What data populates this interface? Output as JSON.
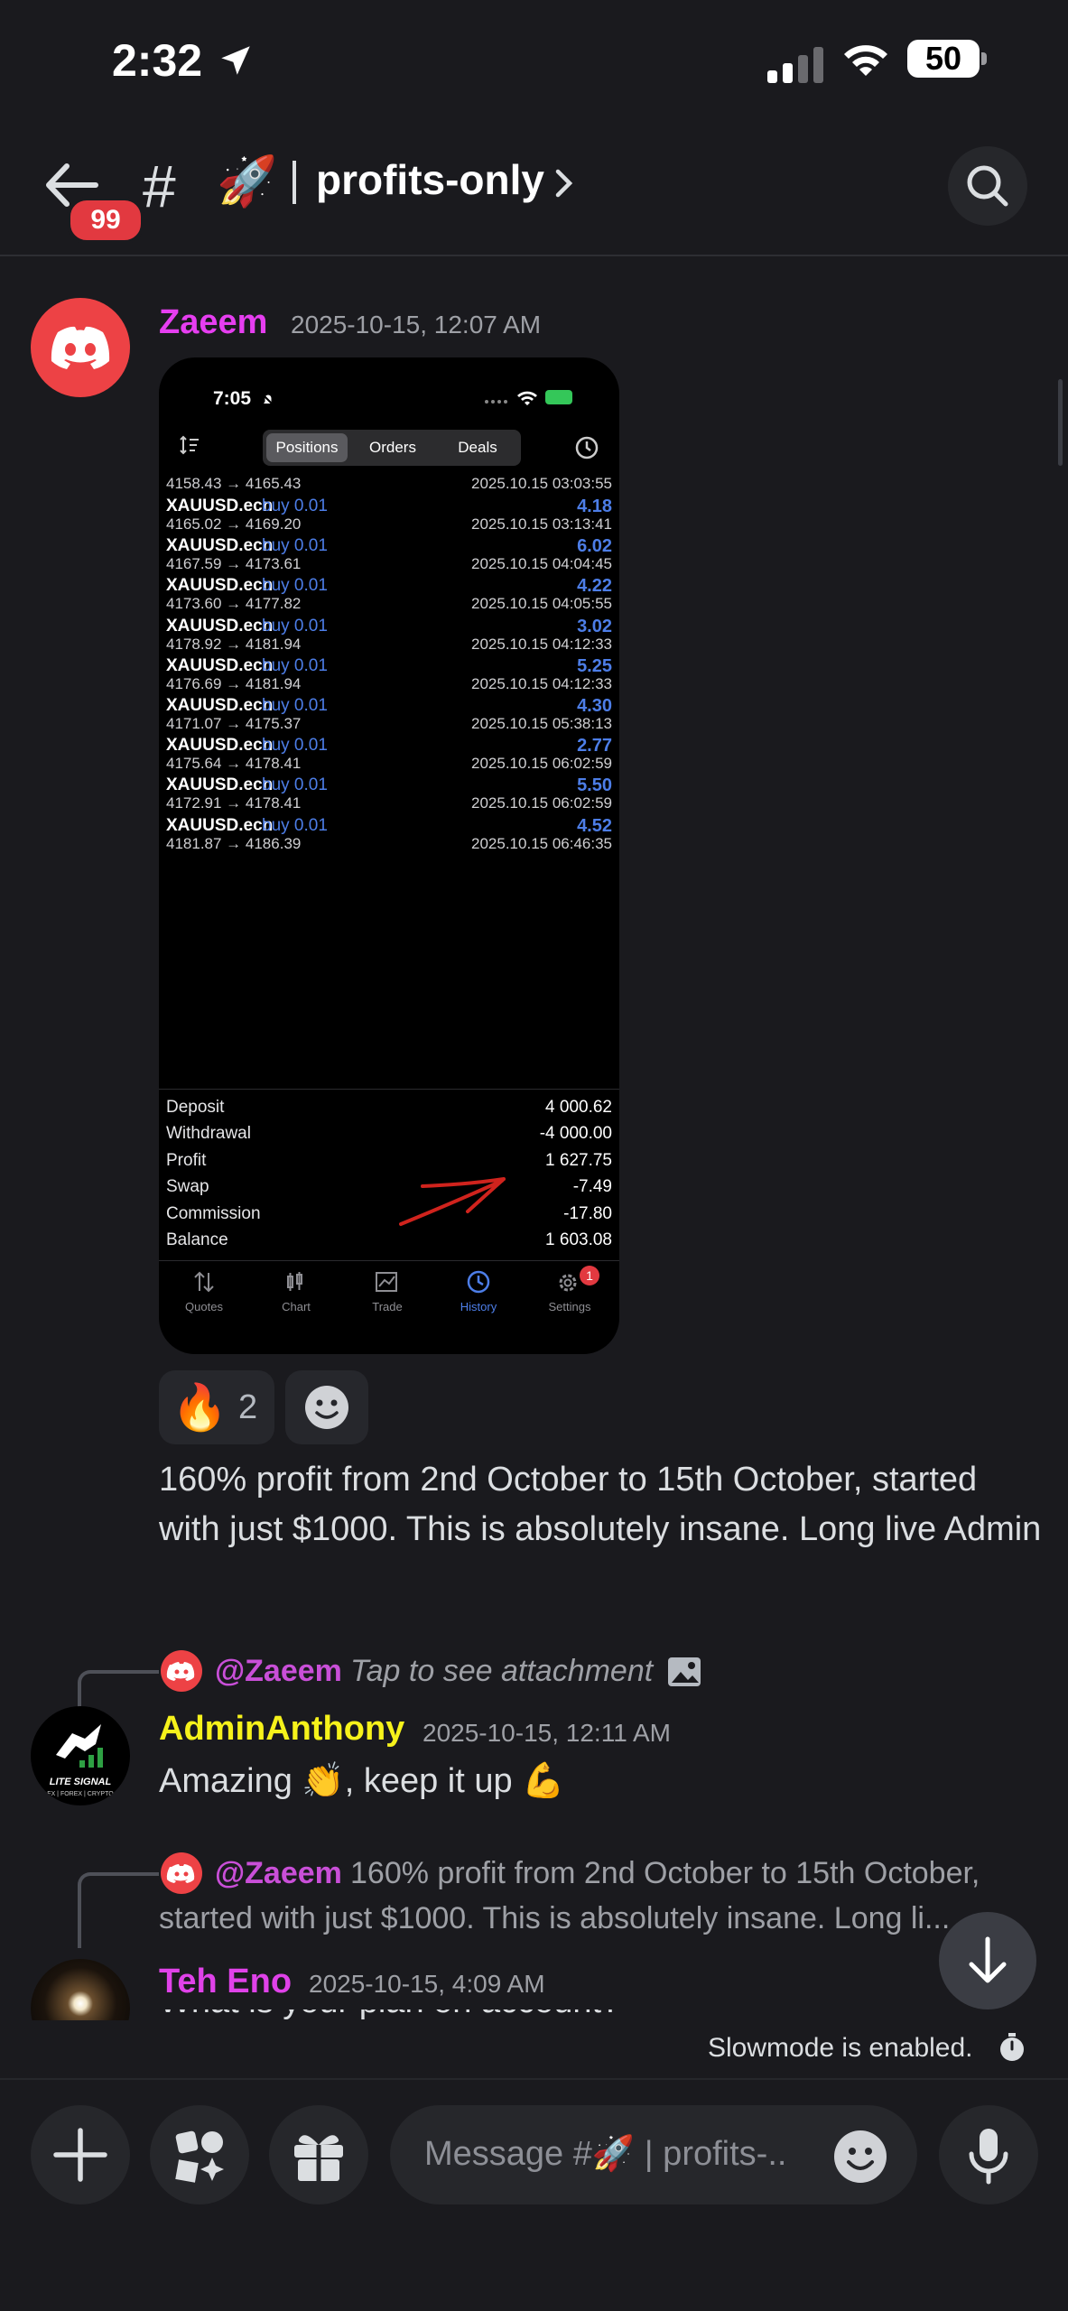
{
  "status": {
    "time": "2:32",
    "battery": "50"
  },
  "header": {
    "badge": "99",
    "hash": "#",
    "emoji": "🚀",
    "channel": "profits-only"
  },
  "msg1": {
    "author": "Zaeem",
    "timestamp": "2025-10-15, 12:07 AM",
    "screenshot": {
      "time": "7:05",
      "tabs": [
        "Positions",
        "Orders",
        "Deals"
      ],
      "first_row": {
        "prices": "4158.43 → 4165.43",
        "date": "2025.10.15 03:03:55"
      },
      "rows": [
        {
          "symbol": "XAUUSD.ecn",
          "side": "buy 0.01",
          "profit": "4.18",
          "prices": "4165.02 → 4169.20",
          "date": "2025.10.15 03:13:41"
        },
        {
          "symbol": "XAUUSD.ecn",
          "side": "buy 0.01",
          "profit": "6.02",
          "prices": "4167.59 → 4173.61",
          "date": "2025.10.15 04:04:45"
        },
        {
          "symbol": "XAUUSD.ecn",
          "side": "buy 0.01",
          "profit": "4.22",
          "prices": "4173.60 → 4177.82",
          "date": "2025.10.15 04:05:55"
        },
        {
          "symbol": "XAUUSD.ecn",
          "side": "buy 0.01",
          "profit": "3.02",
          "prices": "4178.92 → 4181.94",
          "date": "2025.10.15 04:12:33"
        },
        {
          "symbol": "XAUUSD.ecn",
          "side": "buy 0.01",
          "profit": "5.25",
          "prices": "4176.69 → 4181.94",
          "date": "2025.10.15 04:12:33"
        },
        {
          "symbol": "XAUUSD.ecn",
          "side": "buy 0.01",
          "profit": "4.30",
          "prices": "4171.07 → 4175.37",
          "date": "2025.10.15 05:38:13"
        },
        {
          "symbol": "XAUUSD.ecn",
          "side": "buy 0.01",
          "profit": "2.77",
          "prices": "4175.64 → 4178.41",
          "date": "2025.10.15 06:02:59"
        },
        {
          "symbol": "XAUUSD.ecn",
          "side": "buy 0.01",
          "profit": "5.50",
          "prices": "4172.91 → 4178.41",
          "date": "2025.10.15 06:02:59"
        },
        {
          "symbol": "XAUUSD.ecn",
          "side": "buy 0.01",
          "profit": "4.52",
          "prices": "4181.87 → 4186.39",
          "date": "2025.10.15 06:46:35"
        }
      ],
      "summary": [
        {
          "label": "Deposit",
          "value": "4 000.62"
        },
        {
          "label": "Withdrawal",
          "value": "-4 000.00"
        },
        {
          "label": "Profit",
          "value": "1 627.75"
        },
        {
          "label": "Swap",
          "value": "-7.49"
        },
        {
          "label": "Commission",
          "value": "-17.80"
        },
        {
          "label": "Balance",
          "value": "1 603.08"
        }
      ],
      "tabbar": [
        "Quotes",
        "Chart",
        "Trade",
        "History",
        "Settings"
      ],
      "settings_badge": "1"
    },
    "reaction_emoji": "🔥",
    "reaction_count": "2",
    "text": "160% profit from 2nd October to 15th October, started with just $1000. This is absolutely insane. Long live Admin"
  },
  "msg2": {
    "reply_mention": "@Zaeem",
    "reply_text": "Tap to see attachment",
    "author": "AdminAnthony",
    "timestamp": "2025-10-15, 12:11 AM",
    "text": "Amazing 👏,  keep it up 💪",
    "avatar_text": "LITE SIGNAL",
    "avatar_subtext": "FX | FOREX | CRYPTO"
  },
  "msg3": {
    "reply_mention": "@Zaeem",
    "reply_text_line1": "160% profit from 2nd October to 15th October,",
    "reply_text_line2": "started with just $1000. This is absolutely insane. Long li...",
    "author": "Teh Eno",
    "timestamp": "2025-10-15, 4:09 AM",
    "text_partial": "What is your plan on account?"
  },
  "composer": {
    "slowmode": "Slowmode is enabled.",
    "placeholder": "Message #🚀 | profits-.."
  },
  "colors": {
    "bg": "#1a1a1e",
    "mention": "#c94fd8",
    "zaeem": "#e63ef0",
    "admin": "#f6f21b",
    "teheno": "#e042e9",
    "blurple": "#4d7ee8"
  }
}
